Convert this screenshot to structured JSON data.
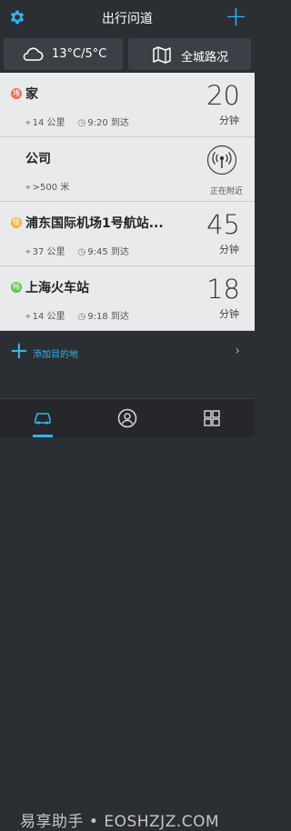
{
  "header": {
    "title": "出行问道"
  },
  "weather": {
    "temperature": "13°C/5°C"
  },
  "traffic": {
    "label": "全城路况"
  },
  "destinations": [
    {
      "badge": "堵",
      "badge_color": "#f26d4f",
      "name": "家",
      "distance": "14 公里",
      "arrival": "9:20 到达",
      "duration": "20",
      "unit": "分钟"
    },
    {
      "name": "公司",
      "distance": ">500 米",
      "status": "正在附近"
    },
    {
      "badge": "慢",
      "badge_color": "#f3b42d",
      "name": "浦东国际机场1号航站...",
      "distance": "37 公里",
      "arrival": "9:45 到达",
      "duration": "45",
      "unit": "分钟"
    },
    {
      "badge": "畅",
      "badge_color": "#5fc24e",
      "name": "上海火车站",
      "distance": "14 公里",
      "arrival": "9:18 到达",
      "duration": "18",
      "unit": "分钟"
    }
  ],
  "add_destination": {
    "label": "添加目的地"
  },
  "watermark": "易享助手 • EOSHZJZ.COM",
  "colors": {
    "accent": "#2fb5f3",
    "background": "#2b2e33",
    "card": "#e9eaec"
  }
}
